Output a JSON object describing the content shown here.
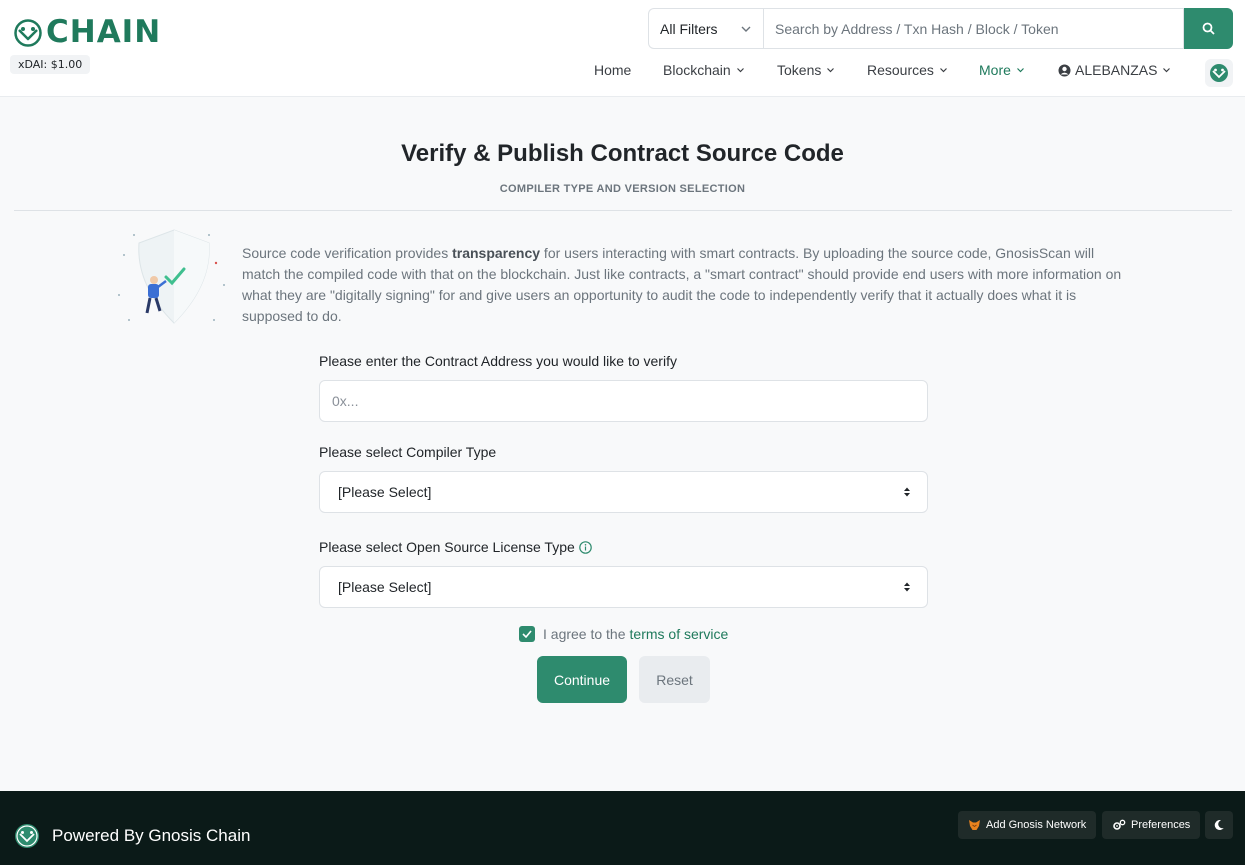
{
  "header": {
    "logo_text": "CHAIN",
    "price": "xDAI: $1.00",
    "filter_label": "All Filters",
    "search_placeholder": "Search by Address / Txn Hash / Block / Token",
    "nav": [
      {
        "label": "Home"
      },
      {
        "label": "Blockchain"
      },
      {
        "label": "Tokens"
      },
      {
        "label": "Resources"
      },
      {
        "label": "More"
      },
      {
        "label": "ALEBANZAS"
      }
    ]
  },
  "main": {
    "title": "Verify & Publish Contract Source Code",
    "subtitle": "COMPILER TYPE AND VERSION SELECTION",
    "intro_before": "Source code verification provides ",
    "intro_bold": "transparency",
    "intro_after": " for users interacting with smart contracts. By uploading the source code, GnosisScan will match the compiled code with that on the blockchain. Just like contracts, a \"smart contract\" should provide end users with more information on what they are \"digitally signing\" for and give users an opportunity to audit the code to independently verify that it actually does what it is supposed to do.",
    "address_label": "Please enter the Contract Address you would like to verify",
    "address_placeholder": "0x...",
    "compiler_label": "Please select Compiler Type",
    "compiler_value": "[Please Select]",
    "license_label": "Please select Open Source License Type",
    "license_value": "[Please Select]",
    "agree_text": "I agree to the",
    "tos_link": "terms of service",
    "continue_label": "Continue",
    "reset_label": "Reset"
  },
  "footer": {
    "powered_by": "Powered By Gnosis Chain",
    "add_network": "Add Gnosis Network",
    "preferences": "Preferences"
  },
  "colors": {
    "accent": "#2e8b6e",
    "footer_bg": "#0b1a18"
  }
}
